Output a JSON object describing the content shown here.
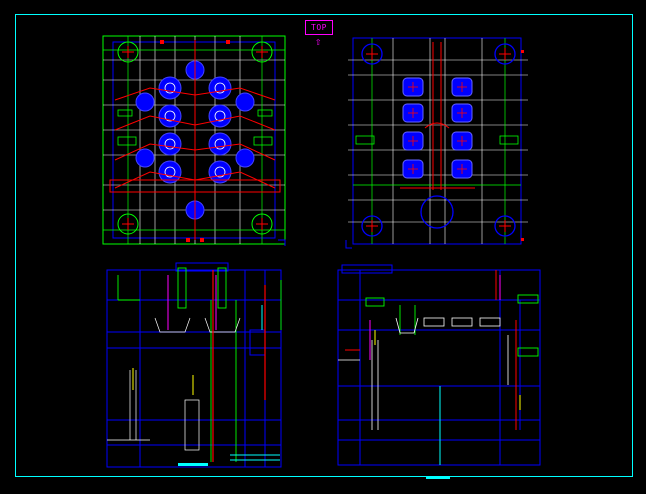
{
  "view_label": "TOP",
  "colors": {
    "background": "#000000",
    "frame": "#00ffff",
    "outline": "#0000ff",
    "green": "#00ff00",
    "red": "#ff0000",
    "white": "#ffffff",
    "magenta": "#ff00ff",
    "yellow": "#ffff00"
  },
  "icons": {
    "view_arrow": "up-arrow-icon"
  }
}
